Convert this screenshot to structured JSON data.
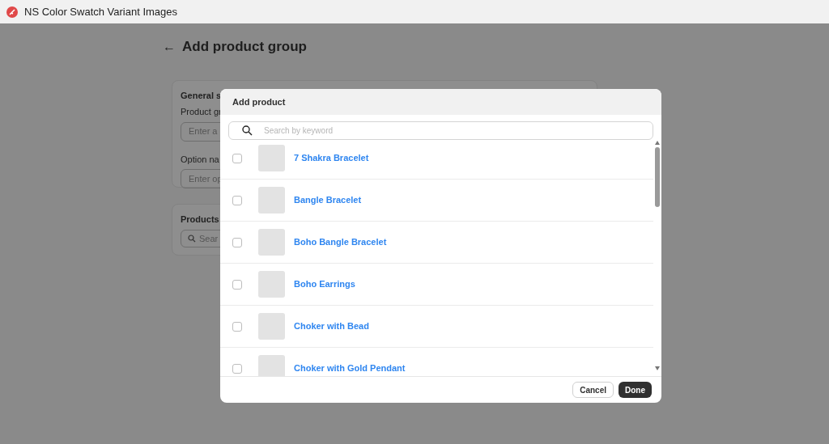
{
  "window": {
    "title": "NS Color Swatch Variant Images"
  },
  "page": {
    "back": "←",
    "title": "Add product group",
    "general_settings": {
      "title": "General s",
      "fields": [
        {
          "label": "Product gr",
          "placeholder": "Enter a"
        },
        {
          "label": "Option na",
          "placeholder": "Enter op"
        }
      ]
    },
    "products": {
      "title": "Products",
      "search_placeholder": "Sear"
    }
  },
  "modal": {
    "title": "Add product",
    "search": {
      "placeholder": "Search by keyword"
    },
    "products": [
      {
        "name": "7 Shakra Bracelet",
        "checked": false
      },
      {
        "name": "Bangle Bracelet",
        "checked": false
      },
      {
        "name": "Boho Bangle Bracelet",
        "checked": false
      },
      {
        "name": "Boho Earrings",
        "checked": false
      },
      {
        "name": "Choker with Bead",
        "checked": false
      },
      {
        "name": "Choker with Gold Pendant",
        "checked": false
      }
    ],
    "buttons": [
      {
        "label": "Cancel",
        "kind": "secondary"
      },
      {
        "label": "Done",
        "kind": "primary"
      }
    ]
  }
}
